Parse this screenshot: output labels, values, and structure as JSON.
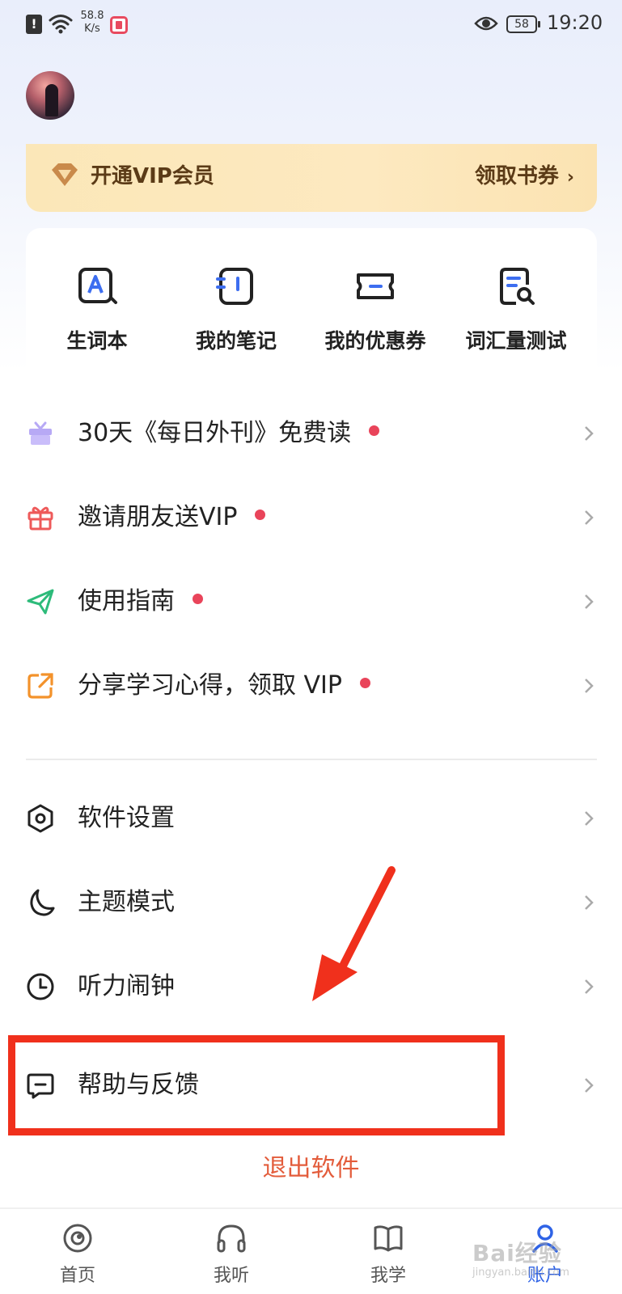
{
  "status_bar": {
    "net_speed_value": "58.8",
    "net_speed_unit": "K/s",
    "battery": "58",
    "time": "19:20"
  },
  "profile": {
    "avatar": "avatar"
  },
  "vip_banner": {
    "title": "开通VIP会员",
    "action": "领取书券"
  },
  "quick_actions": [
    {
      "label": "生词本",
      "icon": "vocab-book-icon"
    },
    {
      "label": "我的笔记",
      "icon": "notes-icon"
    },
    {
      "label": "我的优惠券",
      "icon": "coupon-icon"
    },
    {
      "label": "词汇量测试",
      "icon": "vocab-test-icon"
    }
  ],
  "menu_promos": [
    {
      "label": "30天《每日外刊》免费读",
      "icon": "gift-box-icon",
      "dot": true
    },
    {
      "label": "邀请朋友送VIP",
      "icon": "gift-icon",
      "dot": true
    },
    {
      "label": "使用指南",
      "icon": "paper-plane-icon",
      "dot": true
    },
    {
      "label": "分享学习心得，领取 VIP",
      "icon": "share-icon",
      "dot": true
    }
  ],
  "menu_settings": [
    {
      "label": "软件设置",
      "icon": "settings-icon"
    },
    {
      "label": "主题模式",
      "icon": "moon-icon"
    },
    {
      "label": "听力闹钟",
      "icon": "clock-icon"
    },
    {
      "label": "帮助与反馈",
      "icon": "feedback-icon"
    }
  ],
  "logout": "退出软件",
  "bottom_nav": [
    {
      "label": "首页",
      "icon": "home-icon"
    },
    {
      "label": "我听",
      "icon": "headphones-icon"
    },
    {
      "label": "我学",
      "icon": "book-icon"
    },
    {
      "label": "账户",
      "icon": "account-icon",
      "active": true
    }
  ],
  "watermark": {
    "text": "Bai经验",
    "sub": "jingyan.baidu.com"
  },
  "colors": {
    "accent_blue": "#2f63e6",
    "red_dot": "#e9445a",
    "logout_text": "#e35c3b",
    "highlight": "#f0301c",
    "vip_bg": "#fde9c0"
  }
}
